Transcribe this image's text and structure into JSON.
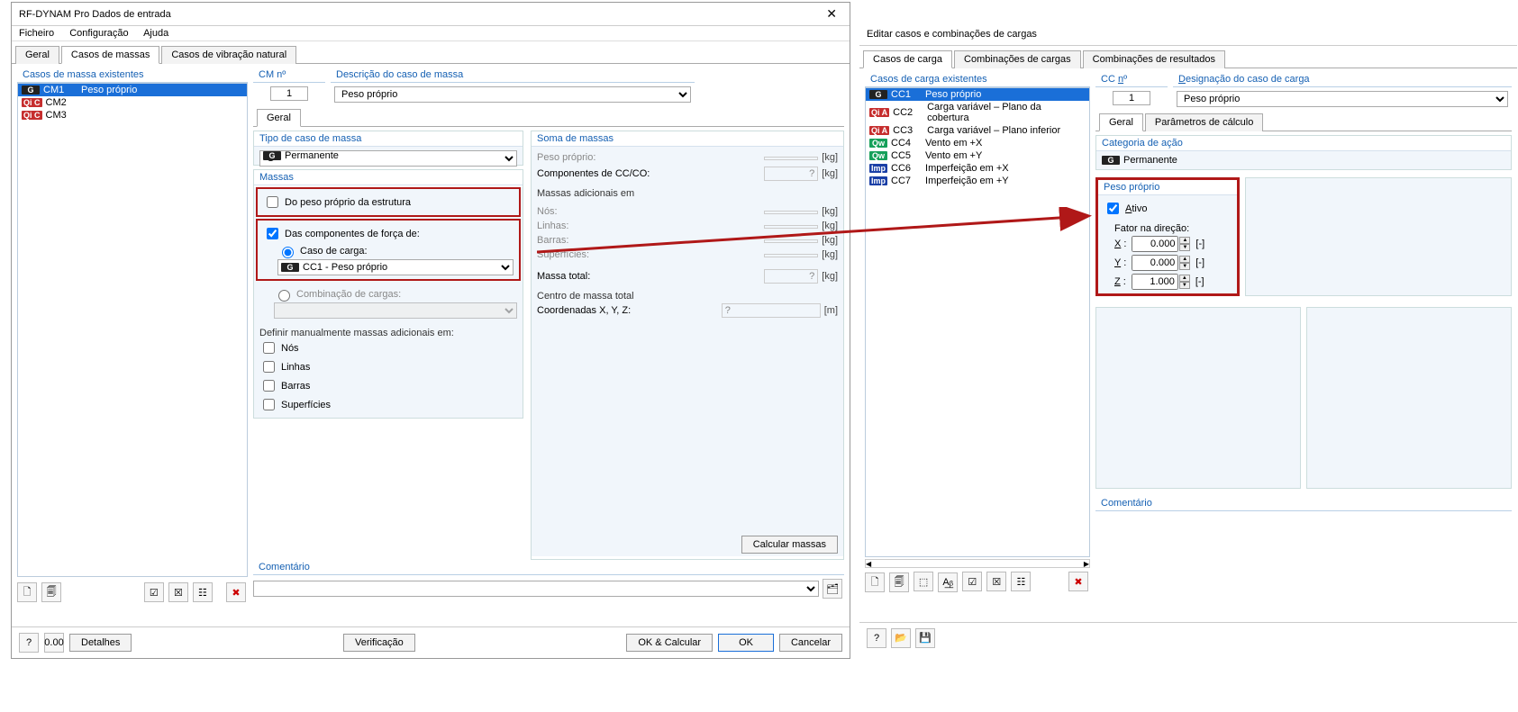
{
  "left": {
    "title": "RF-DYNAM Pro Dados de entrada",
    "menu": {
      "file": "Ficheiro",
      "config": "Configuração",
      "help": "Ajuda"
    },
    "tabs": {
      "geral": "Geral",
      "casos": "Casos de massas",
      "vib": "Casos de vibração natural"
    },
    "masscases_head": "Casos de massa existentes",
    "masscases": [
      {
        "tag": "G",
        "tagcls": "tag-G",
        "id": "CM1",
        "desc": "Peso próprio",
        "sel": true
      },
      {
        "tag": "Qi C",
        "tagcls": "tag-QiC",
        "id": "CM2",
        "desc": "",
        "sel": false
      },
      {
        "tag": "Qi C",
        "tagcls": "tag-QiC",
        "id": "CM3",
        "desc": "",
        "sel": false
      }
    ],
    "cm_no_lbl": "CM nº",
    "cm_no": "1",
    "desc_lbl": "Descrição do caso de massa",
    "desc_val": "Peso próprio",
    "geral_tab": "Geral",
    "tipo_lbl": "Tipo de caso de massa",
    "tipo_val": "Permanente",
    "massas_lbl": "Massas",
    "ck_peso": "Do peso próprio da estrutura",
    "ck_comp": "Das componentes de força de:",
    "rad_caso": "Caso de carga:",
    "caso_val": "CC1 - Peso próprio",
    "rad_comb": "Combinação de cargas:",
    "def_lbl": "Definir manualmente massas adicionais em:",
    "ck_nos": "Nós",
    "ck_lin": "Linhas",
    "ck_bar": "Barras",
    "ck_sup": "Superfícies",
    "soma_lbl": "Soma de massas",
    "rows": {
      "peso": "Peso próprio:",
      "comp": "Componentes de CC/CO:",
      "comp_v": "?",
      "adic": "Massas adicionais em",
      "nos": "Nós:",
      "lin": "Linhas:",
      "bar": "Barras:",
      "sup": "Superfícies:",
      "total": "Massa total:",
      "total_v": "?",
      "centro": "Centro de massa total",
      "coord": "Coordenadas X, Y, Z:",
      "coord_v": "?"
    },
    "kg": "[kg]",
    "m": "[m]",
    "calc_btn": "Calcular massas",
    "coment": "Comentário",
    "verif": "Verificação",
    "det": "Detalhes",
    "okcalc": "OK & Calcular",
    "ok": "OK",
    "cancel": "Cancelar"
  },
  "right": {
    "title": "Editar casos e combinações de cargas",
    "tabs": {
      "cc": "Casos de carga",
      "comb": "Combinações de cargas",
      "res": "Combinações de resultados"
    },
    "list_head": "Casos de carga existentes",
    "cc_no_lbl": "CC nº",
    "cc_no": "1",
    "desig_lbl": "Designação do caso de carga",
    "desig_val": "Peso próprio",
    "cases": [
      {
        "tag": "G",
        "cls": "tag-G",
        "id": "CC1",
        "desc": "Peso próprio",
        "sel": true
      },
      {
        "tag": "Qi A",
        "cls": "tag-QiA",
        "id": "CC2",
        "desc": "Carga variável – Plano da cobertura"
      },
      {
        "tag": "Qi A",
        "cls": "tag-QiA",
        "id": "CC3",
        "desc": "Carga variável – Plano inferior"
      },
      {
        "tag": "Qw",
        "cls": "tag-Qw",
        "id": "CC4",
        "desc": "Vento em +X"
      },
      {
        "tag": "Qw",
        "cls": "tag-Qw",
        "id": "CC5",
        "desc": "Vento em +Y"
      },
      {
        "tag": "Imp",
        "cls": "tag-Imp",
        "id": "CC6",
        "desc": "Imperfeição em +X"
      },
      {
        "tag": "Imp",
        "cls": "tag-Imp",
        "id": "CC7",
        "desc": "Imperfeição em +Y"
      }
    ],
    "subtabs": {
      "geral": "Geral",
      "param": "Parâmetros de cálculo"
    },
    "cat_lbl": "Categoria de ação",
    "cat_val": "Permanente",
    "peso_lbl": "Peso próprio",
    "ativo": "Ativo",
    "fator": "Fator na direção:",
    "x": "X :",
    "y": "Y :",
    "z": "Z :",
    "xv": "0.000",
    "yv": "0.000",
    "zv": "1.000",
    "un": "[-]",
    "coment": "Comentário"
  }
}
